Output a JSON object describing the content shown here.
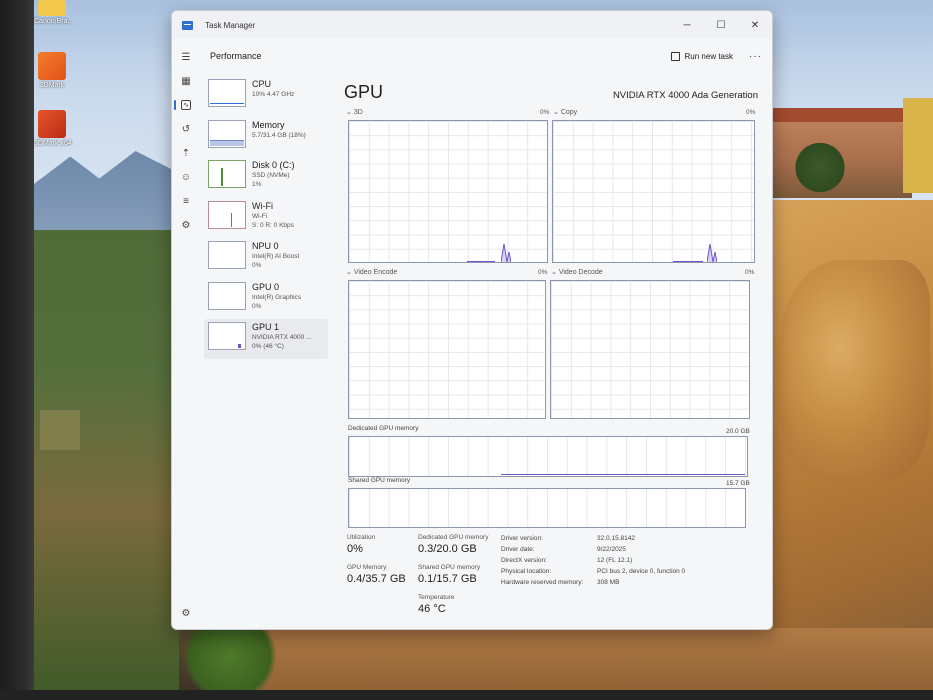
{
  "desktop": {
    "icons": [
      {
        "label": "Canon/Bra..."
      },
      {
        "label": "3DMark"
      },
      {
        "label": "3DMark.x64"
      }
    ]
  },
  "window": {
    "title": "Task Manager",
    "controls": {
      "minimize": "─",
      "maximize": "☐",
      "close": "✕"
    }
  },
  "toolbar": {
    "heading": "Performance",
    "run_new_task": "Run new task",
    "more": "···"
  },
  "devices": [
    {
      "name": "CPU",
      "line1": "10% 4.47 GHz",
      "line2": ""
    },
    {
      "name": "Memory",
      "line1": "5.7/31.4 GB (18%)",
      "line2": ""
    },
    {
      "name": "Disk 0 (C:)",
      "line1": "SSD (NVMe)",
      "line2": "1%"
    },
    {
      "name": "Wi-Fi",
      "line1": "Wi-Fi",
      "line2": "S: 0 R: 0 Kbps"
    },
    {
      "name": "NPU 0",
      "line1": "Intel(R) AI Boost",
      "line2": "0%"
    },
    {
      "name": "GPU 0",
      "line1": "Intel(R) Graphics",
      "line2": "0%"
    },
    {
      "name": "GPU 1",
      "line1": "NVIDIA RTX 4000 ...",
      "line2": "0% (46 °C)"
    }
  ],
  "gpu": {
    "title": "GPU",
    "model": "NVIDIA RTX 4000 Ada Generation",
    "engines": [
      {
        "label": "3D",
        "pct": "0%"
      },
      {
        "label": "Copy",
        "pct": "0%"
      },
      {
        "label": "Video Encode",
        "pct": "0%"
      },
      {
        "label": "Video Decode",
        "pct": "0%"
      }
    ],
    "dedicated_label": "Dedicated GPU memory",
    "dedicated_max": "20.0 GB",
    "shared_label": "Shared GPU memory",
    "shared_max": "15.7 GB"
  },
  "stats": {
    "utilization_label": "Utilization",
    "utilization": "0%",
    "gpu_memory_label": "GPU Memory",
    "gpu_memory": "0.4/35.7 GB",
    "dedicated_label": "Dedicated GPU memory",
    "dedicated": "0.3/20.0 GB",
    "shared_label": "Shared GPU memory",
    "shared": "0.1/15.7 GB",
    "temperature_label": "Temperature",
    "temperature": "46 °C",
    "details": [
      {
        "key": "Driver version:",
        "value": "32.0.15.8142"
      },
      {
        "key": "Driver date:",
        "value": "9/22/2025"
      },
      {
        "key": "DirectX version:",
        "value": "12 (FL 12.1)"
      },
      {
        "key": "Physical location:",
        "value": "PCI bus 2, device 0, function 0"
      },
      {
        "key": "Hardware reserved memory:",
        "value": "308 MB"
      }
    ]
  },
  "colors": {
    "accent": "#2f6fd1",
    "gpu_line": "#6a54c9"
  }
}
